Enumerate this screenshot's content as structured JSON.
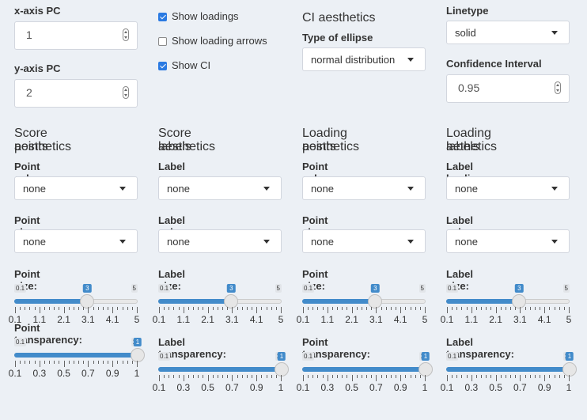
{
  "pcs": {
    "x_label": "x-axis PC",
    "x_value": "1",
    "y_label": "y-axis PC",
    "y_value": "2"
  },
  "toggles": [
    {
      "label": "Show loadings",
      "checked": true
    },
    {
      "label": "Show loading arrows",
      "checked": false
    },
    {
      "label": "Show CI",
      "checked": true
    }
  ],
  "ci": {
    "heading": "CI aesthetics",
    "ellipse_label": "Type of ellipse",
    "ellipse_value": "normal distribution",
    "linetype_label": "Linetype",
    "linetype_value": "solid",
    "confidence_label": "Confidence Interval",
    "confidence_value": "0.95"
  },
  "panels": [
    {
      "heading1": "Score points",
      "heading2": "aesthetics",
      "sel1_label": "Point colour:",
      "sel1_value": "none",
      "sel2_label": "Point shape:",
      "sel2_value": "none",
      "size_label": "Point size:",
      "trans_label": "Point transparency:"
    },
    {
      "heading1": "Score labels",
      "heading2": "aesthetics",
      "sel1_label": "Label scores by:",
      "sel1_value": "none",
      "sel2_label": "Label colour:",
      "sel2_value": "none",
      "size_label": "Label size:",
      "trans_label": "Label transparency:"
    },
    {
      "heading1": "Loading points",
      "heading2": "aesthetics",
      "sel1_label": "Point colour:",
      "sel1_value": "none",
      "sel2_label": "Point shape:",
      "sel2_value": "none",
      "size_label": "Point size:",
      "trans_label": "Point transparency:"
    },
    {
      "heading1": "Loading labels",
      "heading2": "aethetics",
      "sel1_label": "Label loadings by:",
      "sel1_value": "none",
      "sel2_label": "Label colour:",
      "sel2_value": "none",
      "size_label": "Label size:",
      "trans_label": "Label transparency:"
    }
  ],
  "size_slider": {
    "min": "0.1",
    "max": "5",
    "value": "3",
    "value_fraction": 0.5918,
    "grid_labels": [
      "0.1",
      "1.1",
      "2.1",
      "3.1",
      "4.1",
      "5"
    ]
  },
  "trans_slider": {
    "min": "0.1",
    "max": "1",
    "value": "1",
    "value_fraction": 1.0,
    "grid_labels": [
      "0.1",
      "0.3",
      "0.5",
      "0.7",
      "0.9",
      "1"
    ]
  },
  "colors": {
    "accent": "#428bca",
    "background": "#ecf0f5",
    "checkbox": "#2a7ae2"
  }
}
